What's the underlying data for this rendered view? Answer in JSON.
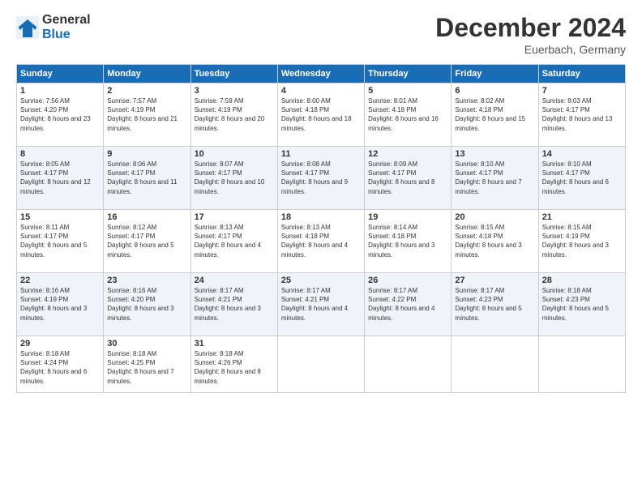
{
  "logo": {
    "general": "General",
    "blue": "Blue"
  },
  "header": {
    "month": "December 2024",
    "location": "Euerbach, Germany"
  },
  "weekdays": [
    "Sunday",
    "Monday",
    "Tuesday",
    "Wednesday",
    "Thursday",
    "Friday",
    "Saturday"
  ],
  "weeks": [
    [
      {
        "day": "1",
        "sunrise": "7:56 AM",
        "sunset": "4:20 PM",
        "daylight": "8 hours and 23 minutes."
      },
      {
        "day": "2",
        "sunrise": "7:57 AM",
        "sunset": "4:19 PM",
        "daylight": "8 hours and 21 minutes."
      },
      {
        "day": "3",
        "sunrise": "7:59 AM",
        "sunset": "4:19 PM",
        "daylight": "8 hours and 20 minutes."
      },
      {
        "day": "4",
        "sunrise": "8:00 AM",
        "sunset": "4:18 PM",
        "daylight": "8 hours and 18 minutes."
      },
      {
        "day": "5",
        "sunrise": "8:01 AM",
        "sunset": "4:18 PM",
        "daylight": "8 hours and 16 minutes."
      },
      {
        "day": "6",
        "sunrise": "8:02 AM",
        "sunset": "4:18 PM",
        "daylight": "8 hours and 15 minutes."
      },
      {
        "day": "7",
        "sunrise": "8:03 AM",
        "sunset": "4:17 PM",
        "daylight": "8 hours and 13 minutes."
      }
    ],
    [
      {
        "day": "8",
        "sunrise": "8:05 AM",
        "sunset": "4:17 PM",
        "daylight": "8 hours and 12 minutes."
      },
      {
        "day": "9",
        "sunrise": "8:06 AM",
        "sunset": "4:17 PM",
        "daylight": "8 hours and 11 minutes."
      },
      {
        "day": "10",
        "sunrise": "8:07 AM",
        "sunset": "4:17 PM",
        "daylight": "8 hours and 10 minutes."
      },
      {
        "day": "11",
        "sunrise": "8:08 AM",
        "sunset": "4:17 PM",
        "daylight": "8 hours and 9 minutes."
      },
      {
        "day": "12",
        "sunrise": "8:09 AM",
        "sunset": "4:17 PM",
        "daylight": "8 hours and 8 minutes."
      },
      {
        "day": "13",
        "sunrise": "8:10 AM",
        "sunset": "4:17 PM",
        "daylight": "8 hours and 7 minutes."
      },
      {
        "day": "14",
        "sunrise": "8:10 AM",
        "sunset": "4:17 PM",
        "daylight": "8 hours and 6 minutes."
      }
    ],
    [
      {
        "day": "15",
        "sunrise": "8:11 AM",
        "sunset": "4:17 PM",
        "daylight": "8 hours and 5 minutes."
      },
      {
        "day": "16",
        "sunrise": "8:12 AM",
        "sunset": "4:17 PM",
        "daylight": "8 hours and 5 minutes."
      },
      {
        "day": "17",
        "sunrise": "8:13 AM",
        "sunset": "4:17 PM",
        "daylight": "8 hours and 4 minutes."
      },
      {
        "day": "18",
        "sunrise": "8:13 AM",
        "sunset": "4:18 PM",
        "daylight": "8 hours and 4 minutes."
      },
      {
        "day": "19",
        "sunrise": "8:14 AM",
        "sunset": "4:18 PM",
        "daylight": "8 hours and 3 minutes."
      },
      {
        "day": "20",
        "sunrise": "8:15 AM",
        "sunset": "4:18 PM",
        "daylight": "8 hours and 3 minutes."
      },
      {
        "day": "21",
        "sunrise": "8:15 AM",
        "sunset": "4:19 PM",
        "daylight": "8 hours and 3 minutes."
      }
    ],
    [
      {
        "day": "22",
        "sunrise": "8:16 AM",
        "sunset": "4:19 PM",
        "daylight": "8 hours and 3 minutes."
      },
      {
        "day": "23",
        "sunrise": "8:16 AM",
        "sunset": "4:20 PM",
        "daylight": "8 hours and 3 minutes."
      },
      {
        "day": "24",
        "sunrise": "8:17 AM",
        "sunset": "4:21 PM",
        "daylight": "8 hours and 3 minutes."
      },
      {
        "day": "25",
        "sunrise": "8:17 AM",
        "sunset": "4:21 PM",
        "daylight": "8 hours and 4 minutes."
      },
      {
        "day": "26",
        "sunrise": "8:17 AM",
        "sunset": "4:22 PM",
        "daylight": "8 hours and 4 minutes."
      },
      {
        "day": "27",
        "sunrise": "8:17 AM",
        "sunset": "4:23 PM",
        "daylight": "8 hours and 5 minutes."
      },
      {
        "day": "28",
        "sunrise": "8:18 AM",
        "sunset": "4:23 PM",
        "daylight": "8 hours and 5 minutes."
      }
    ],
    [
      {
        "day": "29",
        "sunrise": "8:18 AM",
        "sunset": "4:24 PM",
        "daylight": "8 hours and 6 minutes."
      },
      {
        "day": "30",
        "sunrise": "8:18 AM",
        "sunset": "4:25 PM",
        "daylight": "8 hours and 7 minutes."
      },
      {
        "day": "31",
        "sunrise": "8:18 AM",
        "sunset": "4:26 PM",
        "daylight": "8 hours and 8 minutes."
      },
      null,
      null,
      null,
      null
    ]
  ]
}
